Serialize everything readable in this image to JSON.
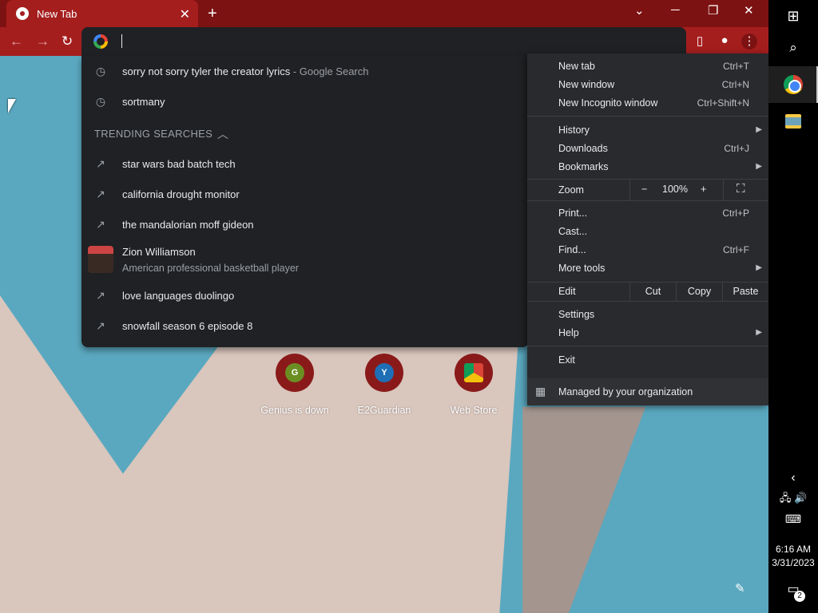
{
  "tab": {
    "title": "New Tab",
    "close": "✕"
  },
  "tabstrip": {
    "new_tab": "+",
    "tab_search": "⌄",
    "minimize": "─",
    "restore": "❐",
    "close": "✕"
  },
  "toolbar": {
    "back": "←",
    "forward": "→",
    "reload": "↻"
  },
  "omnibox": {
    "value": ""
  },
  "suggestions": {
    "history": [
      {
        "text": "sorry not sorry tyler the creator lyrics",
        "sub": " - Google Search"
      },
      {
        "text": "sortmany",
        "sub": ""
      }
    ],
    "trending_header": "TRENDING SEARCHES",
    "trending": [
      "star wars bad batch tech",
      "california drought monitor",
      "the mandalorian moff gideon",
      "love languages duolingo",
      "snowfall season 6 episode 8"
    ],
    "entity": {
      "name": "Zion Williamson",
      "desc": "American professional basketball player"
    }
  },
  "shortcuts": [
    {
      "letter": "G",
      "label": "Genius is down",
      "color": "#6b8e23"
    },
    {
      "letter": "Y",
      "label": "E2Guardian",
      "color": "#1e6fb5"
    },
    {
      "letter": "",
      "label": "Web Store",
      "color": "#ffffff"
    }
  ],
  "menu": {
    "new_tab": "New tab",
    "new_tab_sc": "Ctrl+T",
    "new_window": "New window",
    "new_window_sc": "Ctrl+N",
    "incognito": "New Incognito window",
    "incognito_sc": "Ctrl+Shift+N",
    "history": "History",
    "downloads": "Downloads",
    "downloads_sc": "Ctrl+J",
    "bookmarks": "Bookmarks",
    "zoom": "Zoom",
    "zoom_minus": "−",
    "zoom_value": "100%",
    "zoom_plus": "+",
    "print": "Print...",
    "print_sc": "Ctrl+P",
    "cast": "Cast...",
    "find": "Find...",
    "find_sc": "Ctrl+F",
    "more_tools": "More tools",
    "edit": "Edit",
    "cut": "Cut",
    "copy": "Copy",
    "paste": "Paste",
    "settings": "Settings",
    "help": "Help",
    "exit": "Exit",
    "managed": "Managed by your organization"
  },
  "taskbar": {
    "time": "6:16 AM",
    "date": "3/31/2023",
    "notifications": "2"
  },
  "colors": {
    "frame": "#a51e1e",
    "menu_bg": "#292a2d",
    "omnibox_bg": "#202124"
  }
}
